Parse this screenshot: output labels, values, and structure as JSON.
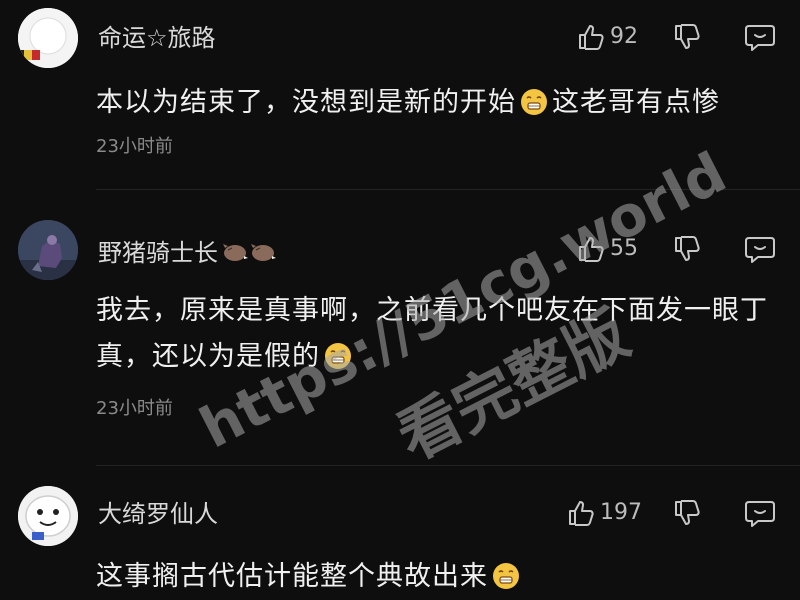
{
  "comments": [
    {
      "username": "命运☆旅路",
      "likes": "92",
      "text_before_emoji": "本以为结束了，没想到是新的开始",
      "text_after_emoji": "这老哥有点惨",
      "timestamp": "23小时前"
    },
    {
      "username": "野猪骑士长",
      "likes": "55",
      "text_line1": "我去，原来是真事啊，之前看几个吧友在下面发一眼丁",
      "text_line2": "真，还以为是假的",
      "timestamp": "23小时前"
    },
    {
      "username": "大绮罗仙人",
      "likes": "197",
      "text": "这事搁古代估计能整个典故出来"
    }
  ],
  "watermark": {
    "line1": "https://51cg.world",
    "line2": "看完整版"
  },
  "icons": {
    "like": "thumbs-up-icon",
    "dislike": "thumbs-down-icon",
    "reply": "comment-bubble-icon",
    "emoji": "awkward-smile-emoji"
  },
  "colors": {
    "background": "#0e0e0f",
    "text": "#f0f0f0",
    "muted": "#8a8a8a",
    "watermark": "#aaaaaa"
  }
}
